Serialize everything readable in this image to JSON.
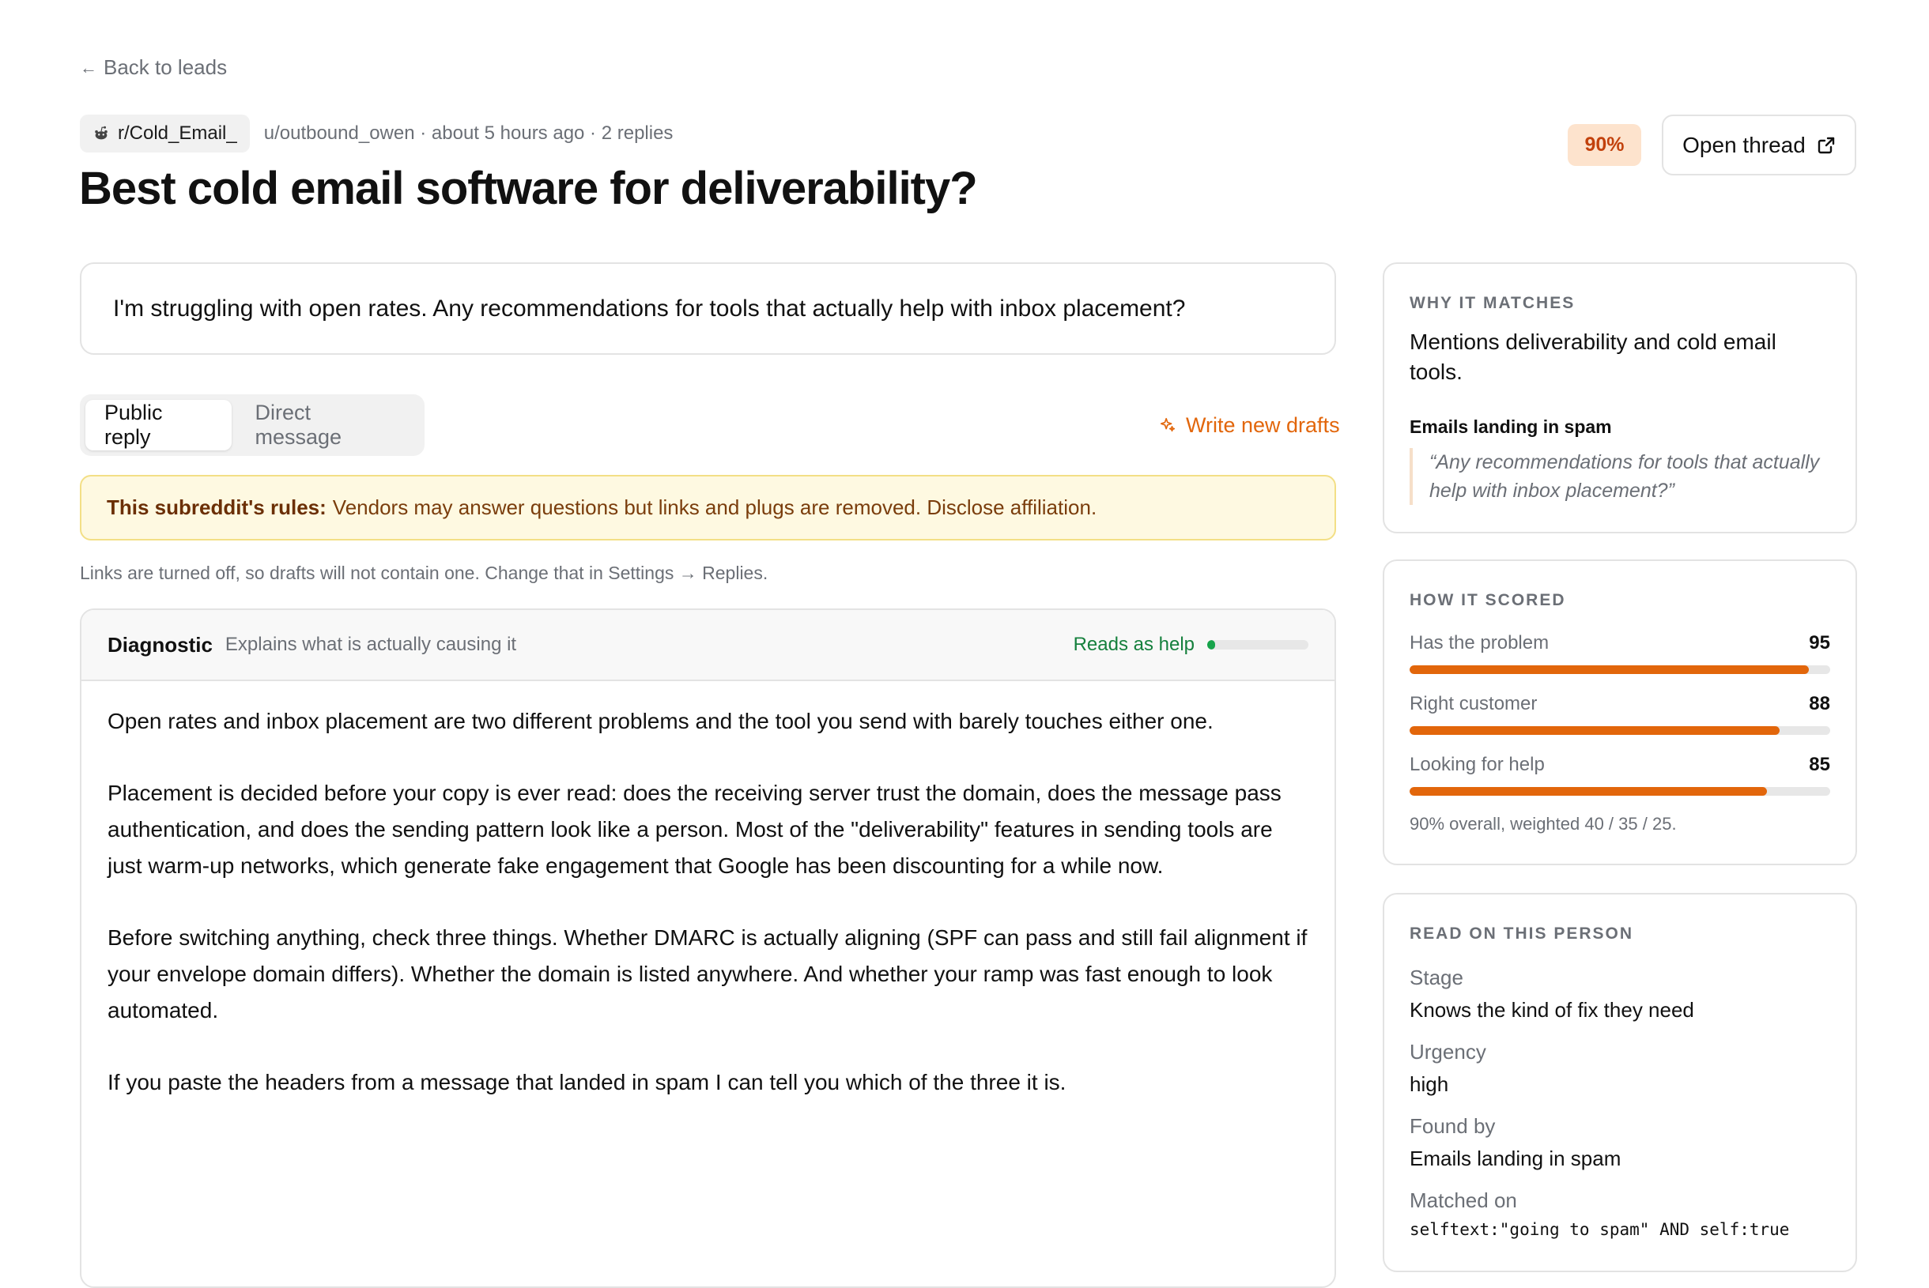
{
  "nav": {
    "back_arrow": "←",
    "back_label": "Back to leads"
  },
  "post": {
    "subreddit": "r/Cold_Email_",
    "meta": "u/outbound_owen · about 5 hours ago · 2 replies",
    "title": "Best cold email software for deliverability?",
    "body": "I'm struggling with open rates. Any recommendations for tools that actually help with inbox placement?",
    "score": "90%"
  },
  "actions": {
    "open_thread": "Open thread",
    "write_drafts": "Write new drafts"
  },
  "tabs": [
    {
      "label": "Public reply",
      "active": true
    },
    {
      "label": "Direct message",
      "active": false
    }
  ],
  "rules": {
    "label": "This subreddit's rules:",
    "text": "Vendors may answer questions but links and plugs are removed. Disclose affiliation."
  },
  "links_note": "Links are turned off, so drafts will not contain one. Change that in Settings → Replies.",
  "draft": {
    "name": "Diagnostic",
    "description": "Explains what is actually causing it",
    "reads_label": "Reads as help",
    "reads_level": 0.08,
    "paragraphs": [
      "Open rates and inbox placement are two different problems and the tool you send with barely touches either one.",
      "Placement is decided before your copy is ever read: does the receiving server trust the domain, does the message pass authentication, and does the sending pattern look like a person. Most of the \"deliverability\" features in sending tools are just warm-up networks, which generate fake engagement that Google has been discounting for a while now.",
      "Before switching anything, check three things. Whether DMARC is actually aligning (SPF can pass and still fail alignment if your envelope domain differs). Whether the domain is listed anywhere. And whether your ramp was fast enough to look automated.",
      "If you paste the headers from a message that landed in spam I can tell you which of the three it is."
    ]
  },
  "why": {
    "heading": "WHY IT MATCHES",
    "text": "Mentions deliverability and cold email tools.",
    "signal": "Emails landing in spam",
    "quote": "“Any recommendations for tools that actually help with inbox placement?”"
  },
  "scored": {
    "heading": "HOW IT SCORED",
    "metrics": [
      {
        "label": "Has the problem",
        "value": "95",
        "level": 95
      },
      {
        "label": "Right customer",
        "value": "88",
        "level": 88
      },
      {
        "label": "Looking for help",
        "value": "85",
        "level": 85
      }
    ],
    "summary": "90% overall, weighted 40 / 35 / 25."
  },
  "person": {
    "heading": "READ ON THIS PERSON",
    "fields": [
      {
        "label": "Stage",
        "value": "Knows the kind of fix they need"
      },
      {
        "label": "Urgency",
        "value": "high"
      },
      {
        "label": "Found by",
        "value": "Emails landing in spam"
      },
      {
        "label": "Matched on",
        "value": "selftext:\"going to spam\" AND self:true"
      }
    ]
  },
  "colors": {
    "accent": "#e2660b",
    "help_green": "#16a34a",
    "rules_bg": "#fef9e1"
  }
}
